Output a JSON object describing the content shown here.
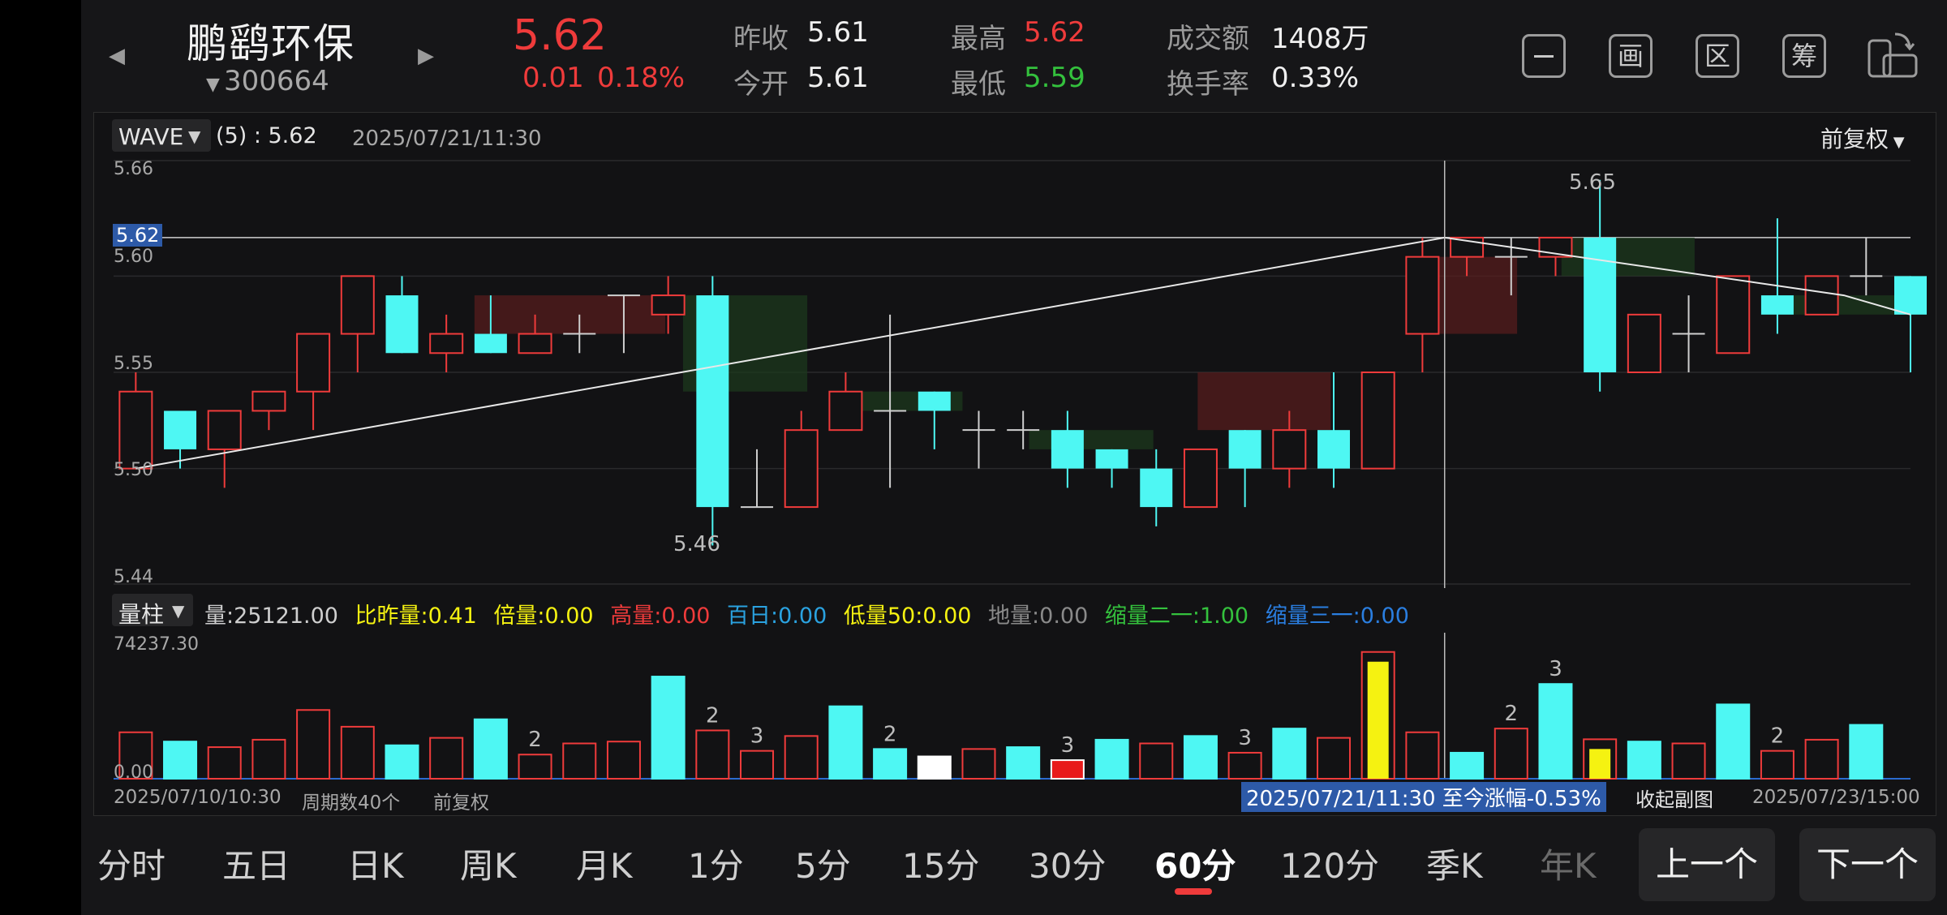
{
  "stock": {
    "name": "鹏鹞环保",
    "code": "300664",
    "price": "5.62",
    "change": "0.01",
    "change_pct": "0.18%"
  },
  "quote": {
    "prev_close_label": "昨收",
    "prev_close": "5.61",
    "open_label": "今开",
    "open": "5.61",
    "high_label": "最高",
    "high": "5.62",
    "low_label": "最低",
    "low": "5.59",
    "amount_label": "成交额",
    "amount": "1408万",
    "turnover_label": "换手率",
    "turnover": "0.33%"
  },
  "toolbar": {
    "icons": [
      "minus-box-icon",
      "draw-icon",
      "region-icon",
      "chips-icon",
      "rotate-screen-icon"
    ],
    "btn_draw": "画",
    "btn_region": "区",
    "btn_chips": "筹"
  },
  "chart": {
    "indicator": "WAVE",
    "indicator_params": "(5) : 5.62",
    "cursor_time": "2025/07/21/11:30",
    "adjust": "前复权",
    "y_ticks": [
      "5.66",
      "5.60",
      "5.55",
      "5.50",
      "5.44"
    ],
    "cursor_price": "5.62",
    "high_note": "5.65",
    "low_note": "5.46"
  },
  "chart_data": [
    {
      "type": "candlestick",
      "title": "",
      "xlabel": "",
      "ylabel": "",
      "ylim": [
        5.44,
        5.66
      ],
      "x_start": "2025/07/10/10:30",
      "x_end": "2025/07/23/15:00",
      "bars": [
        {
          "o": 5.5,
          "h": 5.55,
          "l": 5.5,
          "c": 5.54
        },
        {
          "o": 5.53,
          "h": 5.53,
          "l": 5.5,
          "c": 5.51
        },
        {
          "o": 5.51,
          "h": 5.53,
          "l": 5.49,
          "c": 5.53
        },
        {
          "o": 5.53,
          "h": 5.54,
          "l": 5.52,
          "c": 5.54
        },
        {
          "o": 5.54,
          "h": 5.57,
          "l": 5.52,
          "c": 5.57
        },
        {
          "o": 5.57,
          "h": 5.6,
          "l": 5.55,
          "c": 5.6
        },
        {
          "o": 5.59,
          "h": 5.6,
          "l": 5.56,
          "c": 5.56
        },
        {
          "o": 5.56,
          "h": 5.58,
          "l": 5.55,
          "c": 5.57
        },
        {
          "o": 5.57,
          "h": 5.59,
          "l": 5.56,
          "c": 5.56
        },
        {
          "o": 5.56,
          "h": 5.58,
          "l": 5.56,
          "c": 5.57
        },
        {
          "o": 5.57,
          "h": 5.58,
          "l": 5.56,
          "c": 5.57
        },
        {
          "o": 5.59,
          "h": 5.59,
          "l": 5.56,
          "c": 5.59
        },
        {
          "o": 5.58,
          "h": 5.6,
          "l": 5.57,
          "c": 5.59
        },
        {
          "o": 5.59,
          "h": 5.6,
          "l": 5.46,
          "c": 5.48
        },
        {
          "o": 5.48,
          "h": 5.51,
          "l": 5.48,
          "c": 5.48
        },
        {
          "o": 5.48,
          "h": 5.53,
          "l": 5.48,
          "c": 5.52
        },
        {
          "o": 5.52,
          "h": 5.55,
          "l": 5.52,
          "c": 5.54
        },
        {
          "o": 5.53,
          "h": 5.58,
          "l": 5.49,
          "c": 5.53
        },
        {
          "o": 5.54,
          "h": 5.54,
          "l": 5.51,
          "c": 5.53
        },
        {
          "o": 5.52,
          "h": 5.53,
          "l": 5.5,
          "c": 5.52
        },
        {
          "o": 5.52,
          "h": 5.53,
          "l": 5.51,
          "c": 5.52
        },
        {
          "o": 5.52,
          "h": 5.53,
          "l": 5.49,
          "c": 5.5
        },
        {
          "o": 5.51,
          "h": 5.51,
          "l": 5.49,
          "c": 5.5
        },
        {
          "o": 5.5,
          "h": 5.51,
          "l": 5.47,
          "c": 5.48
        },
        {
          "o": 5.48,
          "h": 5.51,
          "l": 5.48,
          "c": 5.51
        },
        {
          "o": 5.52,
          "h": 5.52,
          "l": 5.48,
          "c": 5.5
        },
        {
          "o": 5.5,
          "h": 5.53,
          "l": 5.49,
          "c": 5.52
        },
        {
          "o": 5.52,
          "h": 5.55,
          "l": 5.49,
          "c": 5.5
        },
        {
          "o": 5.5,
          "h": 5.55,
          "l": 5.5,
          "c": 5.55
        },
        {
          "o": 5.57,
          "h": 5.62,
          "l": 5.55,
          "c": 5.61
        },
        {
          "o": 5.61,
          "h": 5.62,
          "l": 5.6,
          "c": 5.62
        },
        {
          "o": 5.61,
          "h": 5.62,
          "l": 5.59,
          "c": 5.61
        },
        {
          "o": 5.61,
          "h": 5.62,
          "l": 5.6,
          "c": 5.62
        },
        {
          "o": 5.62,
          "h": 5.65,
          "l": 5.54,
          "c": 5.55
        },
        {
          "o": 5.55,
          "h": 5.58,
          "l": 5.55,
          "c": 5.58
        },
        {
          "o": 5.57,
          "h": 5.59,
          "l": 5.55,
          "c": 5.57
        },
        {
          "o": 5.56,
          "h": 5.6,
          "l": 5.56,
          "c": 5.6
        },
        {
          "o": 5.59,
          "h": 5.63,
          "l": 5.57,
          "c": 5.58
        },
        {
          "o": 5.58,
          "h": 5.6,
          "l": 5.58,
          "c": 5.6
        },
        {
          "o": 5.6,
          "h": 5.62,
          "l": 5.59,
          "c": 5.6
        },
        {
          "o": 5.6,
          "h": 5.6,
          "l": 5.55,
          "c": 5.58
        }
      ],
      "wave_line": [
        {
          "bar": 0,
          "price": 5.5
        },
        {
          "bar": 29.5,
          "price": 5.62
        },
        {
          "bar": 38.5,
          "price": 5.59
        },
        {
          "bar": 40,
          "price": 5.58
        }
      ]
    },
    {
      "type": "bar",
      "title": "",
      "ylim": [
        0.0,
        74237.3
      ],
      "values": [
        25000,
        20000,
        17000,
        21000,
        37000,
        28000,
        18000,
        22000,
        32000,
        13000,
        19000,
        20000,
        55000,
        26000,
        15000,
        23000,
        39000,
        16000,
        12000,
        16000,
        17000,
        10000,
        21000,
        19000,
        23000,
        14000,
        27000,
        22000,
        63000,
        25000,
        14000,
        27000,
        51000,
        16000,
        20000,
        19000,
        40000,
        15000,
        21000,
        29000
      ],
      "up": [
        true,
        false,
        true,
        true,
        true,
        true,
        false,
        true,
        false,
        true,
        true,
        true,
        false,
        true,
        true,
        true,
        false,
        false,
        true,
        true,
        false,
        true,
        false,
        true,
        false,
        true,
        false,
        true,
        true,
        true,
        false,
        true,
        false,
        true,
        false,
        true,
        false,
        true,
        true,
        false
      ],
      "labels": {
        "9": "2",
        "13": "2",
        "14": "3",
        "17": "2",
        "21": "3",
        "25": "3",
        "31": "2",
        "32": "3",
        "37": "2"
      },
      "colors": {
        "white": [
          18
        ],
        "red_fill": [
          21
        ],
        "yellow": [
          28,
          33
        ]
      }
    }
  ],
  "volume": {
    "selector": "量柱",
    "vol_label": "量:",
    "vol": "25121.00",
    "ratio_label": "比昨量:",
    "ratio": "0.41",
    "times_label": "倍量:",
    "times": "0.00",
    "high_label": "高量:",
    "high": "0.00",
    "hundred_label": "百日:",
    "hundred": "0.00",
    "low50_label": "低量50:",
    "low50": "0.00",
    "ground_label": "地量:",
    "ground": "0.00",
    "shrink21_label": "缩量二一:",
    "shrink21": "1.00",
    "shrink31_label": "缩量三一:",
    "shrink31": "0.00",
    "max": "74237.30",
    "zero": "0.00"
  },
  "footer": {
    "start": "2025/07/10/10:30",
    "periods": "周期数40个",
    "adjust": "前复权",
    "range_text": "2025/07/21/11:30 至今涨幅-0.53%",
    "collapse": "收起副图",
    "end": "2025/07/23/15:00"
  },
  "tabs": [
    "分时",
    "五日",
    "日K",
    "周K",
    "月K",
    "1分",
    "5分",
    "15分",
    "30分",
    "60分",
    "120分",
    "季K",
    "年K"
  ],
  "active_tab": "60分",
  "buttons": {
    "prev": "上一个",
    "next": "下一个"
  },
  "colors": {
    "up": "#ef3b3b",
    "down": "#4ef7f3",
    "green": "#34c13d",
    "yellow": "#f5f211",
    "blue": "#2aa2e0",
    "accent": "#ef3b3b"
  }
}
